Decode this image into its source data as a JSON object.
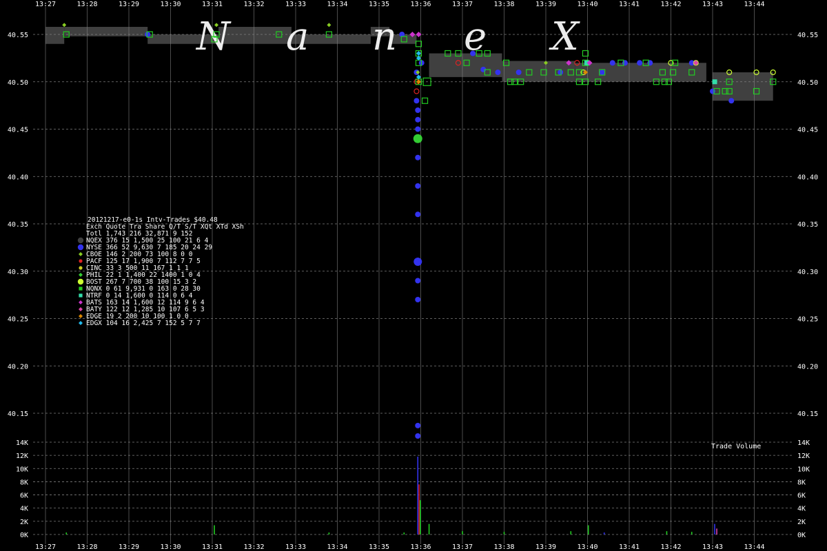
{
  "chart_data": {
    "type": "scatter",
    "title": "20121217-e0-1s Intv-Trades $40.48",
    "watermark": [
      "N",
      "a",
      "n",
      "e",
      "X"
    ],
    "volume_label": "Trade Volume",
    "x_ticks": [
      "13:27",
      "13:28",
      "13:29",
      "13:30",
      "13:31",
      "13:32",
      "13:33",
      "13:34",
      "13:35",
      "13:36",
      "13:37",
      "13:38",
      "13:39",
      "13:40",
      "13:41",
      "13:42",
      "13:43",
      "13:44"
    ],
    "y_ticks": [
      "40.55",
      "40.50",
      "40.45",
      "40.40",
      "40.35",
      "40.30",
      "40.25",
      "40.20",
      "40.15"
    ],
    "y_range": [
      40.13,
      40.57
    ],
    "vol_ticks": [
      "14K",
      "12K",
      "10K",
      "8K",
      "6K",
      "4K",
      "2K",
      "0K"
    ],
    "vol_range": [
      0,
      14000
    ],
    "grid": true,
    "colors": {
      "background": "#000000",
      "grid": "#808080",
      "nbbo": "#404040",
      "text": "#ffffff"
    },
    "nbbo_bands": [
      {
        "t0": 27.0,
        "t1": 27.45,
        "lo": 40.54,
        "hi": 40.558
      },
      {
        "t0": 27.45,
        "t1": 29.45,
        "lo": 40.548,
        "hi": 40.558
      },
      {
        "t0": 29.45,
        "t1": 31.15,
        "lo": 40.54,
        "hi": 40.55
      },
      {
        "t0": 31.15,
        "t1": 32.9,
        "lo": 40.54,
        "hi": 40.558
      },
      {
        "t0": 32.9,
        "t1": 34.8,
        "lo": 40.54,
        "hi": 40.55
      },
      {
        "t0": 34.8,
        "t1": 35.25,
        "lo": 40.548,
        "hi": 40.558
      },
      {
        "t0": 35.25,
        "t1": 35.9,
        "lo": 40.54,
        "hi": 40.55
      },
      {
        "t0": 36.2,
        "t1": 37.95,
        "lo": 40.505,
        "hi": 40.53
      },
      {
        "t0": 37.95,
        "t1": 39.7,
        "lo": 40.5,
        "hi": 40.522
      },
      {
        "t0": 39.7,
        "t1": 42.85,
        "lo": 40.5,
        "hi": 40.52
      },
      {
        "t0": 43.0,
        "t1": 44.45,
        "lo": 40.48,
        "hi": 40.51
      }
    ],
    "series": [
      {
        "name": "NQEX",
        "color": "#404040",
        "shape": "circle",
        "size": 5,
        "points": []
      },
      {
        "name": "NYSE",
        "color": "#3333ee",
        "shape": "circle",
        "size": 4,
        "points": [
          [
            29.45,
            40.55
          ],
          [
            35.55,
            40.55
          ],
          [
            35.9,
            40.51
          ],
          [
            35.9,
            40.48
          ],
          [
            35.93,
            40.47
          ],
          [
            35.93,
            40.46
          ],
          [
            35.93,
            40.45
          ],
          [
            35.93,
            40.42
          ],
          [
            35.93,
            40.39
          ],
          [
            35.93,
            40.36
          ],
          [
            35.93,
            40.29
          ],
          [
            35.93,
            40.27
          ],
          [
            35.93,
            40.137
          ],
          [
            35.93,
            40.126
          ],
          [
            36.02,
            40.52
          ],
          [
            37.25,
            40.53
          ],
          [
            37.5,
            40.513
          ],
          [
            37.85,
            40.51
          ],
          [
            38.35,
            40.51
          ],
          [
            39.35,
            40.51
          ],
          [
            40.35,
            40.51
          ],
          [
            40.6,
            40.52
          ],
          [
            40.9,
            40.52
          ],
          [
            41.25,
            40.52
          ],
          [
            41.5,
            40.52
          ],
          [
            42.5,
            40.52
          ],
          [
            43.45,
            40.48
          ],
          [
            43.0,
            40.49
          ]
        ]
      },
      {
        "name": "NYSE",
        "color": "#3333ee",
        "shape": "circle",
        "size": 6,
        "points": [
          [
            35.93,
            40.31
          ]
        ]
      },
      {
        "name": "CBOE",
        "color": "#88cc22",
        "shape": "diamond",
        "size": 3,
        "points": [
          [
            27.45,
            40.56
          ],
          [
            31.1,
            40.56
          ],
          [
            33.8,
            40.56
          ],
          [
            35.93,
            40.51
          ],
          [
            39.0,
            40.52
          ]
        ]
      },
      {
        "name": "PACF",
        "color": "#dd2222",
        "shape": "circle",
        "size": 3.5,
        "hollow": true,
        "points": [
          [
            35.9,
            40.49
          ],
          [
            35.9,
            40.5
          ],
          [
            36.9,
            40.52
          ],
          [
            39.75,
            40.52
          ]
        ]
      },
      {
        "name": "PHIL",
        "color": "#33cc33",
        "shape": "circle",
        "size": 6.5,
        "points": [
          [
            35.93,
            40.44
          ]
        ]
      },
      {
        "name": "BOST",
        "color": "#ccff33",
        "shape": "circle",
        "size": 3.5,
        "hollow": true,
        "points": [
          [
            39.9,
            40.51
          ],
          [
            40.0,
            40.52
          ],
          [
            42.0,
            40.52
          ],
          [
            42.6,
            40.52
          ],
          [
            43.4,
            40.51
          ],
          [
            44.05,
            40.51
          ],
          [
            44.45,
            40.51
          ]
        ]
      },
      {
        "name": "NQNX",
        "color": "#22cc22",
        "shape": "square",
        "size": 4,
        "hollow": true,
        "points": [
          [
            27.5,
            40.55
          ],
          [
            29.5,
            40.55
          ],
          [
            31.05,
            40.545
          ],
          [
            31.1,
            40.55
          ],
          [
            32.6,
            40.55
          ],
          [
            33.8,
            40.55
          ],
          [
            35.6,
            40.545
          ],
          [
            35.95,
            40.54
          ],
          [
            35.95,
            40.53
          ],
          [
            35.95,
            40.52
          ],
          [
            36.1,
            40.48
          ],
          [
            36.65,
            40.53
          ],
          [
            36.9,
            40.53
          ],
          [
            37.1,
            40.52
          ],
          [
            37.4,
            40.53
          ],
          [
            37.6,
            40.51
          ],
          [
            37.6,
            40.53
          ],
          [
            38.05,
            40.52
          ],
          [
            38.15,
            40.5
          ],
          [
            38.25,
            40.5
          ],
          [
            38.4,
            40.5
          ],
          [
            38.6,
            40.51
          ],
          [
            38.95,
            40.51
          ],
          [
            39.3,
            40.51
          ],
          [
            39.6,
            40.51
          ],
          [
            39.8,
            40.51
          ],
          [
            39.8,
            40.5
          ],
          [
            39.95,
            40.52
          ],
          [
            39.95,
            40.53
          ],
          [
            39.95,
            40.5
          ],
          [
            40.25,
            40.5
          ],
          [
            40.35,
            40.51
          ],
          [
            40.8,
            40.52
          ],
          [
            41.4,
            40.52
          ],
          [
            41.65,
            40.5
          ],
          [
            41.8,
            40.51
          ],
          [
            41.85,
            40.5
          ],
          [
            41.95,
            40.5
          ],
          [
            42.05,
            40.51
          ],
          [
            42.1,
            40.52
          ],
          [
            42.5,
            40.51
          ],
          [
            43.1,
            40.49
          ],
          [
            43.3,
            40.49
          ],
          [
            43.4,
            40.5
          ],
          [
            43.4,
            40.49
          ],
          [
            44.05,
            40.49
          ],
          [
            44.45,
            40.5
          ],
          [
            35.95,
            40.5
          ]
        ]
      },
      {
        "name": "NQNX",
        "color": "#22cc22",
        "shape": "square",
        "size": 5.5,
        "hollow": true,
        "points": [
          [
            36.15,
            40.5
          ]
        ]
      },
      {
        "name": "NTRF",
        "color": "#33ddaa",
        "shape": "square",
        "size": 3.5,
        "points": [
          [
            39.98,
            40.52
          ],
          [
            43.05,
            40.5
          ]
        ]
      },
      {
        "name": "BATS",
        "color": "#cc33cc",
        "shape": "diamond",
        "size": 4,
        "points": [
          [
            35.95,
            40.55
          ],
          [
            35.8,
            40.55
          ],
          [
            39.55,
            40.52
          ],
          [
            40.05,
            40.52
          ]
        ]
      },
      {
        "name": "BATY",
        "color": "#dd44aa",
        "shape": "diamond",
        "size": 4,
        "points": [
          [
            42.6,
            40.52
          ]
        ]
      },
      {
        "name": "EDGE",
        "color": "#dd8800",
        "shape": "diamond",
        "size": 3.5,
        "points": [
          [
            35.95,
            40.5
          ],
          [
            39.95,
            40.51
          ]
        ]
      },
      {
        "name": "EDGX",
        "color": "#22bbee",
        "shape": "diamond",
        "size": 3.5,
        "points": [
          [
            35.95,
            40.525
          ],
          [
            35.95,
            40.53
          ],
          [
            35.95,
            40.505
          ]
        ]
      }
    ],
    "volume_bars": [
      {
        "t": 35.93,
        "v": 11800,
        "color": "#3333ee"
      },
      {
        "t": 35.96,
        "v": 7600,
        "color": "#dd2222"
      },
      {
        "t": 35.99,
        "v": 5200,
        "color": "#22cc22"
      },
      {
        "t": 36.2,
        "v": 1600,
        "color": "#22cc22"
      },
      {
        "t": 31.05,
        "v": 1400,
        "color": "#22cc22"
      },
      {
        "t": 40.02,
        "v": 1400,
        "color": "#22cc22"
      },
      {
        "t": 43.05,
        "v": 1600,
        "color": "#3333ee"
      },
      {
        "t": 43.1,
        "v": 900,
        "color": "#dd44aa"
      },
      {
        "t": 37.0,
        "v": 500,
        "color": "#22cc22"
      },
      {
        "t": 38.0,
        "v": 400,
        "color": "#22cc22"
      },
      {
        "t": 39.6,
        "v": 500,
        "color": "#22cc22"
      },
      {
        "t": 40.4,
        "v": 300,
        "color": "#3333ee"
      },
      {
        "t": 41.9,
        "v": 500,
        "color": "#22cc22"
      },
      {
        "t": 42.5,
        "v": 400,
        "color": "#22cc22"
      },
      {
        "t": 27.5,
        "v": 300,
        "color": "#22cc22"
      },
      {
        "t": 33.8,
        "v": 300,
        "color": "#22cc22"
      },
      {
        "t": 35.6,
        "v": 300,
        "color": "#22cc22"
      }
    ],
    "legend": {
      "header": "Exch Quote Tra  Share  Q/T   S/T  XQt XTd XSh",
      "total": "Totl 1,743 216 32,871    9   152",
      "rows": [
        {
          "shape": "circle-big",
          "color": "#404040",
          "text": "NQEX   376  15  1,500   25   100  21   6   4"
        },
        {
          "shape": "circle-big",
          "color": "#3333ee",
          "text": "NYSE   366  52  9,630    7   185  20  24  29"
        },
        {
          "shape": "diamond",
          "color": "#88cc22",
          "text": "CBOE   146   2    200   73   100   8   0   0"
        },
        {
          "shape": "circle",
          "color": "#dd2222",
          "text": "PACF   125  17  1,900    7   112   7   7   5"
        },
        {
          "shape": "circle",
          "color": "#cccc22",
          "text": "CINC    33   3    500   11   167   1   1   1"
        },
        {
          "shape": "diamond",
          "color": "#33cc33",
          "text": "PHIL    22   1  1,400   22  1400   1   0   4"
        },
        {
          "shape": "circle-big",
          "color": "#ccff33",
          "text": "BOST   267   7    700   38   100  15   3   2"
        },
        {
          "shape": "square",
          "color": "#22cc22",
          "text": "NQNX     0  61  9,931    0   163   0  28  30"
        },
        {
          "shape": "square",
          "color": "#33ddaa",
          "text": "NTRF     0  14  1,600    0   114   0   6   4"
        },
        {
          "shape": "diamond",
          "color": "#cc33cc",
          "text": "BATS   163  14  1,600   12   114   9   6   4"
        },
        {
          "shape": "diamond",
          "color": "#dd44aa",
          "text": "BATY   122  12  1,285   10   107   6   5   3"
        },
        {
          "shape": "diamond",
          "color": "#dd8800",
          "text": "EDGE    19   2    200   10   100   1   0   0"
        },
        {
          "shape": "diamond",
          "color": "#22bbee",
          "text": "EDGX   104  16  2,425    7   152   5   7   7"
        }
      ]
    }
  }
}
